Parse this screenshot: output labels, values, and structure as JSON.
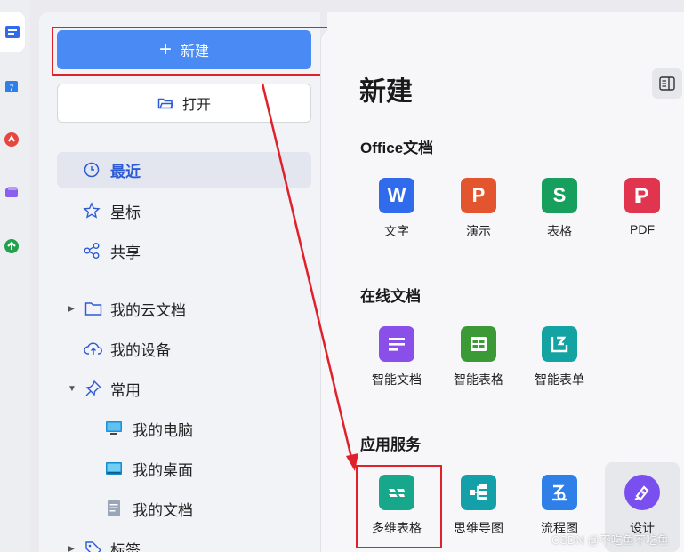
{
  "sidebar": {
    "new_label": "新建",
    "open_label": "打开",
    "nav": [
      {
        "label": "最近",
        "icon": "clock-icon"
      },
      {
        "label": "星标",
        "icon": "star-icon"
      },
      {
        "label": "共享",
        "icon": "share-icon"
      }
    ],
    "tree": [
      {
        "label": "我的云文档",
        "icon": "folder-icon"
      },
      {
        "label": "我的设备",
        "icon": "cloud-upload-icon"
      },
      {
        "label": "常用",
        "icon": "pin-icon"
      }
    ],
    "favorites": [
      {
        "label": "我的电脑",
        "icon": "computer-icon"
      },
      {
        "label": "我的桌面",
        "icon": "desktop-icon"
      },
      {
        "label": "我的文档",
        "icon": "document-icon"
      }
    ],
    "tags_label": "标签"
  },
  "main": {
    "title": "新建",
    "sections": [
      {
        "title": "Office文档",
        "apps": [
          {
            "label": "文字",
            "glyph": "W",
            "color": "#2f6bea"
          },
          {
            "label": "演示",
            "glyph": "P",
            "color": "#e2552f"
          },
          {
            "label": "表格",
            "glyph": "S",
            "color": "#17a05d"
          },
          {
            "label": "PDF",
            "glyph": "P",
            "color": "#e0344f"
          }
        ]
      },
      {
        "title": "在线文档",
        "apps": [
          {
            "label": "智能文档",
            "glyph": "≡",
            "color": "#8a4fe8"
          },
          {
            "label": "智能表格",
            "glyph": "田",
            "color": "#3b9a36"
          },
          {
            "label": "智能表单",
            "glyph": "⌐",
            "color": "#14a3a3"
          }
        ]
      },
      {
        "title": "应用服务",
        "apps": [
          {
            "label": "多维表格",
            "glyph": "≈",
            "color": "#17a78a"
          },
          {
            "label": "思维导图",
            "glyph": "⊞",
            "color": "#14a0a8"
          },
          {
            "label": "流程图",
            "glyph": "∠",
            "color": "#2f7fe8"
          },
          {
            "label": "设计",
            "glyph": "✎",
            "color": "#7a4ff0"
          }
        ]
      }
    ]
  },
  "watermark": "CSDN @不吃鱼不吃鱼",
  "colors": {
    "accent": "#4a8af4",
    "annotation": "#e0202a"
  }
}
